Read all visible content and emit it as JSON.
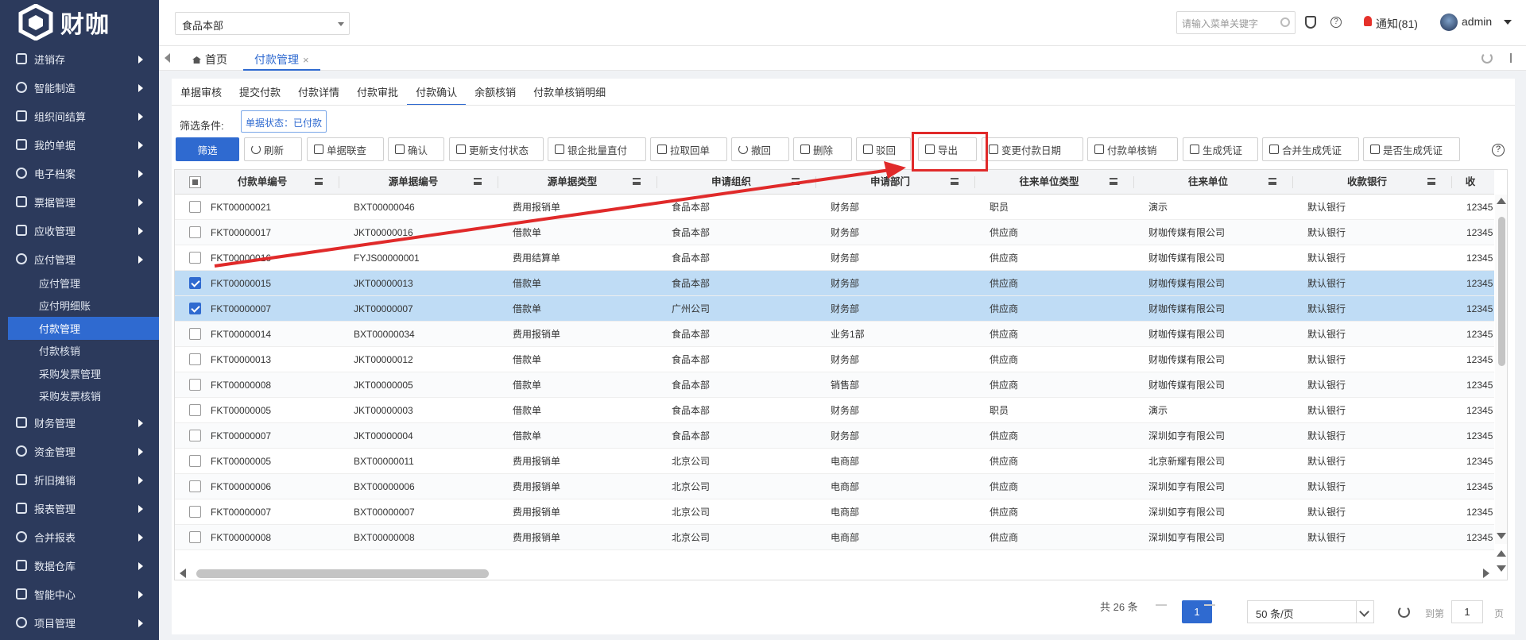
{
  "app": {
    "logo_text": "财咖"
  },
  "sidebar": {
    "items_top": [
      {
        "label": "进销存",
        "icon": "download-tray-icon"
      },
      {
        "label": "智能制造",
        "icon": "gears-icon"
      },
      {
        "label": "组织间结算",
        "icon": "transfer-icon"
      },
      {
        "label": "我的单据",
        "icon": "document-icon"
      },
      {
        "label": "电子档案",
        "icon": "archive-icon"
      },
      {
        "label": "票据管理",
        "icon": "cloud-upload-icon"
      },
      {
        "label": "应收管理",
        "icon": "cloud-upload-icon"
      },
      {
        "label": "应付管理",
        "icon": "cloud-upload-icon"
      }
    ],
    "sub_items": [
      "应付管理",
      "应付明细账",
      "付款管理",
      "付款核销",
      "采购发票管理",
      "采购发票核销"
    ],
    "active_sub": "付款管理",
    "items_bottom": [
      {
        "label": "财务管理",
        "icon": "target-icon"
      },
      {
        "label": "资金管理",
        "icon": "bar-chart-icon"
      },
      {
        "label": "折旧摊销",
        "icon": "loop-icon"
      },
      {
        "label": "报表管理",
        "icon": "report-icon"
      },
      {
        "label": "合并报表",
        "icon": "merge-icon"
      },
      {
        "label": "数据仓库",
        "icon": "bar-chart-icon"
      },
      {
        "label": "智能中心",
        "icon": "compass-icon"
      },
      {
        "label": "项目管理",
        "icon": "bar-chart-icon"
      }
    ]
  },
  "topbar": {
    "org": "食品本部",
    "menu_search_placeholder": "请输入菜单关键字",
    "notice": "通知(81)",
    "user": "admin"
  },
  "tabs": {
    "home": "首页",
    "current": "付款管理",
    "close": "×"
  },
  "subtabs": [
    "单据审核",
    "提交付款",
    "付款详情",
    "付款审批",
    "付款确认",
    "余额核销",
    "付款单核销明细"
  ],
  "active_subtab": "付款确认",
  "filter": {
    "label": "筛选条件:",
    "tag": "单据状态：已付款"
  },
  "toolbar": {
    "filter_btn": "筛选",
    "buttons": [
      "刷新",
      "单据联查",
      "确认",
      "更新支付状态",
      "银企批量直付",
      "拉取回单",
      "撤回",
      "删除",
      "驳回",
      "导出",
      "变更付款日期",
      "付款单核销",
      "生成凭证",
      "合并生成凭证",
      "是否生成凭证"
    ]
  },
  "grid": {
    "columns": [
      "付款单编号",
      "源单据编号",
      "源单据类型",
      "申请组织",
      "申请部门",
      "往来单位类型",
      "往来单位",
      "收款银行",
      "收"
    ],
    "rows": [
      {
        "checked": false,
        "cells": [
          "FKT00000021",
          "BXT00000046",
          "费用报销单",
          "食品本部",
          "财务部",
          "职员",
          "演示",
          "默认银行",
          "12345"
        ]
      },
      {
        "checked": false,
        "cells": [
          "FKT00000017",
          "JKT00000016",
          "借款单",
          "食品本部",
          "财务部",
          "供应商",
          "财咖传媒有限公司",
          "默认银行",
          "12345"
        ]
      },
      {
        "checked": false,
        "cells": [
          "FKT00000016",
          "FYJS00000001",
          "费用结算单",
          "食品本部",
          "财务部",
          "供应商",
          "财咖传媒有限公司",
          "默认银行",
          "12345"
        ]
      },
      {
        "checked": true,
        "cells": [
          "FKT00000015",
          "JKT00000013",
          "借款单",
          "食品本部",
          "财务部",
          "供应商",
          "财咖传媒有限公司",
          "默认银行",
          "12345"
        ]
      },
      {
        "checked": true,
        "cells": [
          "FKT00000007",
          "JKT00000007",
          "借款单",
          "广州公司",
          "财务部",
          "供应商",
          "财咖传媒有限公司",
          "默认银行",
          "12345"
        ]
      },
      {
        "checked": false,
        "cells": [
          "FKT00000014",
          "BXT00000034",
          "费用报销单",
          "食品本部",
          "业务1部",
          "供应商",
          "财咖传媒有限公司",
          "默认银行",
          "12345"
        ]
      },
      {
        "checked": false,
        "cells": [
          "FKT00000013",
          "JKT00000012",
          "借款单",
          "食品本部",
          "财务部",
          "供应商",
          "财咖传媒有限公司",
          "默认银行",
          "12345"
        ]
      },
      {
        "checked": false,
        "cells": [
          "FKT00000008",
          "JKT00000005",
          "借款单",
          "食品本部",
          "销售部",
          "供应商",
          "财咖传媒有限公司",
          "默认银行",
          "12345"
        ]
      },
      {
        "checked": false,
        "cells": [
          "FKT00000005",
          "JKT00000003",
          "借款单",
          "食品本部",
          "财务部",
          "职员",
          "演示",
          "默认银行",
          "12345"
        ]
      },
      {
        "checked": false,
        "cells": [
          "FKT00000007",
          "JKT00000004",
          "借款单",
          "食品本部",
          "财务部",
          "供应商",
          "深圳如亨有限公司",
          "默认银行",
          "12345"
        ]
      },
      {
        "checked": false,
        "cells": [
          "FKT00000005",
          "BXT00000011",
          "费用报销单",
          "北京公司",
          "电商部",
          "供应商",
          "北京新耀有限公司",
          "默认银行",
          "12345"
        ]
      },
      {
        "checked": false,
        "cells": [
          "FKT00000006",
          "BXT00000006",
          "费用报销单",
          "北京公司",
          "电商部",
          "供应商",
          "深圳如亨有限公司",
          "默认银行",
          "12345"
        ]
      },
      {
        "checked": false,
        "cells": [
          "FKT00000007",
          "BXT00000007",
          "费用报销单",
          "北京公司",
          "电商部",
          "供应商",
          "深圳如亨有限公司",
          "默认银行",
          "12345"
        ]
      },
      {
        "checked": false,
        "cells": [
          "FKT00000008",
          "BXT00000008",
          "费用报销单",
          "北京公司",
          "电商部",
          "供应商",
          "深圳如亨有限公司",
          "默认银行",
          "12345"
        ]
      }
    ]
  },
  "pager": {
    "total": "共 26 条",
    "current": "1",
    "page_size": "50 条/页",
    "goto_prefix": "到第",
    "goto_value": "1",
    "goto_suffix": "页"
  },
  "colors": {
    "sidebar_bg": "#2c3a5c",
    "accent": "#2f6ad0",
    "selected_row": "#bfdcf5",
    "annotation": "#e02a2a"
  }
}
